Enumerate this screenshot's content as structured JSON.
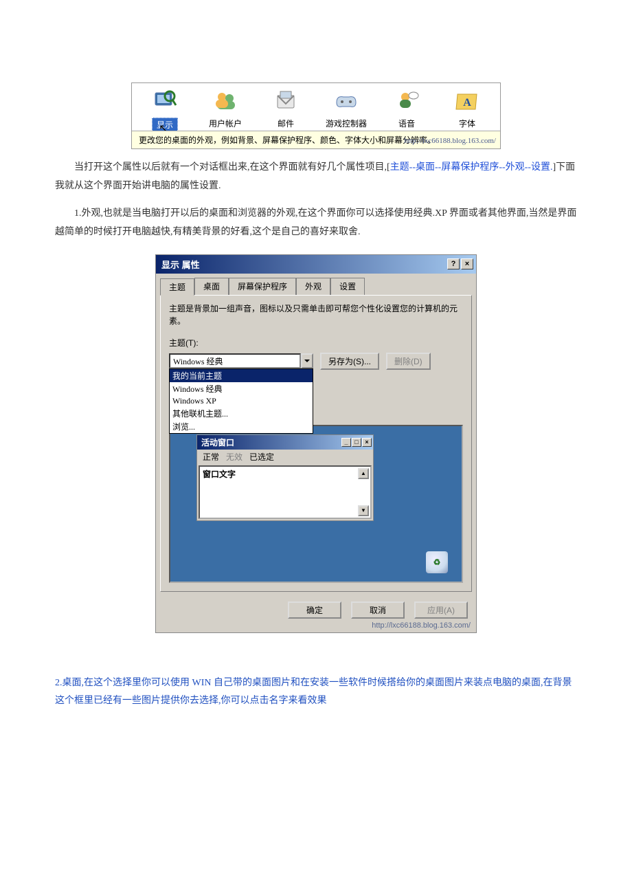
{
  "cpl": {
    "items": [
      {
        "label": "显示",
        "icon": "display"
      },
      {
        "label": "用户帐户",
        "icon": "users"
      },
      {
        "label": "邮件",
        "icon": "mail"
      },
      {
        "label": "游戏控制器",
        "icon": "gamectrl"
      },
      {
        "label": "语音",
        "icon": "speech"
      },
      {
        "label": "字体",
        "icon": "fonts"
      }
    ],
    "tooltip": "更改您的桌面的外观，例如背景、屏幕保护程序、颜色、字体大小和屏幕分辨率。",
    "url": "http://lxc66188.blog.163.com/"
  },
  "para1a": "当打开这个属性以后就有一个对话框出来,在这个界面就有好几个属性项目,[",
  "para1b": "主题--桌面--屏幕保护程序--外观--设置.",
  "para1c": "]下面我就从这个界面开始讲电脑的属性设置.",
  "para2": "1.外观,也就是当电脑打开以后的桌面和浏览器的外观,在这个界面你可以选择使用经典.XP 界面或者其他界面,当然是界面越简单的时候打开电脑越快,有精美背景的好看,这个是自己的喜好来取舍.",
  "dlg": {
    "title": "显示 属性",
    "help_btn": "?",
    "close_btn": "×",
    "tabs": [
      "主题",
      "桌面",
      "屏幕保护程序",
      "外观",
      "设置"
    ],
    "desc": "主题是背景加一组声音，图标以及只需单击即可帮您个性化设置您的计算机的元素。",
    "theme_label": "主题(T):",
    "combo_value": "Windows 经典",
    "saveas": "另存为(S)...",
    "delete": "删除(D)",
    "dropdown": [
      "我的当前主题",
      "Windows 经典",
      "Windows XP",
      "其他联机主题...",
      "浏览..."
    ],
    "active_window": "活动窗口",
    "menu": {
      "normal": "正常",
      "disabled": "无效",
      "selected": "已选定"
    },
    "window_text": "窗口文字",
    "ok": "确定",
    "cancel": "取消",
    "apply": "应用(A)",
    "url": "http://lxc66188.blog.163.com/"
  },
  "sec2": "2.桌面,在这个选择里你可以使用 WIN 自己带的桌面图片和在安装一些软件时候搭给你的桌面图片来装点电脑的桌面,在背景这个框里已经有一些图片提供你去选择,你可以点击名字来看效果"
}
